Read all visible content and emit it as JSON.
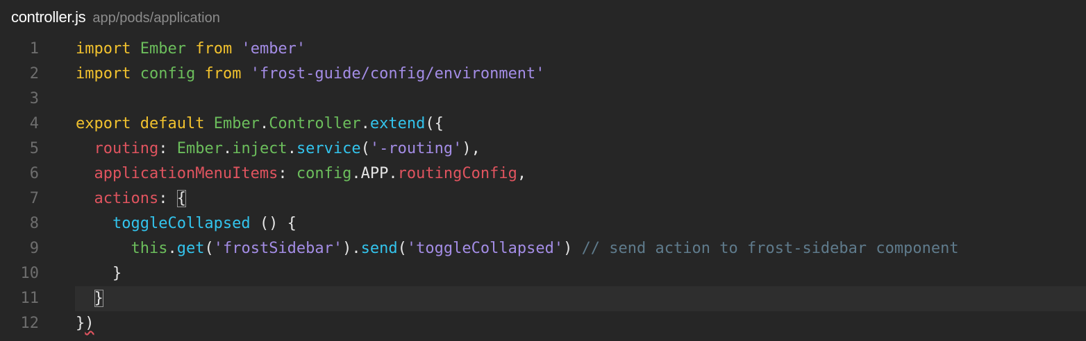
{
  "tab": {
    "filename": "controller.js",
    "path": "app/pods/application"
  },
  "lines": [
    {
      "num": "1",
      "tokens": [
        {
          "t": "import",
          "c": "kw"
        },
        {
          "t": " ",
          "c": "plain"
        },
        {
          "t": "Ember",
          "c": "ctl"
        },
        {
          "t": " ",
          "c": "plain"
        },
        {
          "t": "from",
          "c": "kw"
        },
        {
          "t": " ",
          "c": "plain"
        },
        {
          "t": "'ember'",
          "c": "str"
        }
      ]
    },
    {
      "num": "2",
      "tokens": [
        {
          "t": "import",
          "c": "kw"
        },
        {
          "t": " ",
          "c": "plain"
        },
        {
          "t": "config",
          "c": "ctl"
        },
        {
          "t": " ",
          "c": "plain"
        },
        {
          "t": "from",
          "c": "kw"
        },
        {
          "t": " ",
          "c": "plain"
        },
        {
          "t": "'frost-guide/config/environment'",
          "c": "str"
        }
      ]
    },
    {
      "num": "3",
      "tokens": []
    },
    {
      "num": "4",
      "tokens": [
        {
          "t": "export",
          "c": "kw"
        },
        {
          "t": " ",
          "c": "plain"
        },
        {
          "t": "default",
          "c": "kw"
        },
        {
          "t": " ",
          "c": "plain"
        },
        {
          "t": "Ember",
          "c": "ctl"
        },
        {
          "t": ".",
          "c": "plain"
        },
        {
          "t": "Controller",
          "c": "ctl"
        },
        {
          "t": ".",
          "c": "plain"
        },
        {
          "t": "extend",
          "c": "fn"
        },
        {
          "t": "({",
          "c": "plain"
        }
      ]
    },
    {
      "num": "5",
      "tokens": [
        {
          "t": "  ",
          "c": "plain"
        },
        {
          "t": "routing",
          "c": "prop"
        },
        {
          "t": ": ",
          "c": "plain"
        },
        {
          "t": "Ember",
          "c": "ctl"
        },
        {
          "t": ".",
          "c": "plain"
        },
        {
          "t": "inject",
          "c": "ctl"
        },
        {
          "t": ".",
          "c": "plain"
        },
        {
          "t": "service",
          "c": "fn"
        },
        {
          "t": "(",
          "c": "plain"
        },
        {
          "t": "'-routing'",
          "c": "str"
        },
        {
          "t": "),",
          "c": "plain"
        }
      ]
    },
    {
      "num": "6",
      "tokens": [
        {
          "t": "  ",
          "c": "plain"
        },
        {
          "t": "applicationMenuItems",
          "c": "prop"
        },
        {
          "t": ": ",
          "c": "plain"
        },
        {
          "t": "config",
          "c": "ctl"
        },
        {
          "t": ".",
          "c": "plain"
        },
        {
          "t": "APP",
          "c": "plain"
        },
        {
          "t": ".",
          "c": "plain"
        },
        {
          "t": "routingConfig",
          "c": "prop"
        },
        {
          "t": ",",
          "c": "plain"
        }
      ]
    },
    {
      "num": "7",
      "tokens": [
        {
          "t": "  ",
          "c": "plain"
        },
        {
          "t": "actions",
          "c": "prop"
        },
        {
          "t": ": ",
          "c": "plain"
        },
        {
          "t": "{",
          "c": "plain",
          "box": true
        }
      ]
    },
    {
      "num": "8",
      "tokens": [
        {
          "t": "    ",
          "c": "plain"
        },
        {
          "t": "toggleCollapsed",
          "c": "fn"
        },
        {
          "t": " () {",
          "c": "plain"
        }
      ]
    },
    {
      "num": "9",
      "tokens": [
        {
          "t": "      ",
          "c": "plain"
        },
        {
          "t": "this",
          "c": "ctl"
        },
        {
          "t": ".",
          "c": "plain"
        },
        {
          "t": "get",
          "c": "fn"
        },
        {
          "t": "(",
          "c": "plain"
        },
        {
          "t": "'frostSidebar'",
          "c": "str"
        },
        {
          "t": ").",
          "c": "plain"
        },
        {
          "t": "send",
          "c": "fn"
        },
        {
          "t": "(",
          "c": "plain"
        },
        {
          "t": "'toggleCollapsed'",
          "c": "str"
        },
        {
          "t": ") ",
          "c": "plain"
        },
        {
          "t": "// send action to frost-sidebar component",
          "c": "cmt"
        }
      ]
    },
    {
      "num": "10",
      "tokens": [
        {
          "t": "    }",
          "c": "plain"
        }
      ]
    },
    {
      "num": "11",
      "current": true,
      "tokens": [
        {
          "t": "  ",
          "c": "plain"
        },
        {
          "t": "}",
          "c": "plain",
          "box": true
        }
      ]
    },
    {
      "num": "12",
      "tokens": [
        {
          "t": "}",
          "c": "plain"
        },
        {
          "t": ")",
          "c": "plain",
          "squiggle": true
        }
      ]
    }
  ]
}
